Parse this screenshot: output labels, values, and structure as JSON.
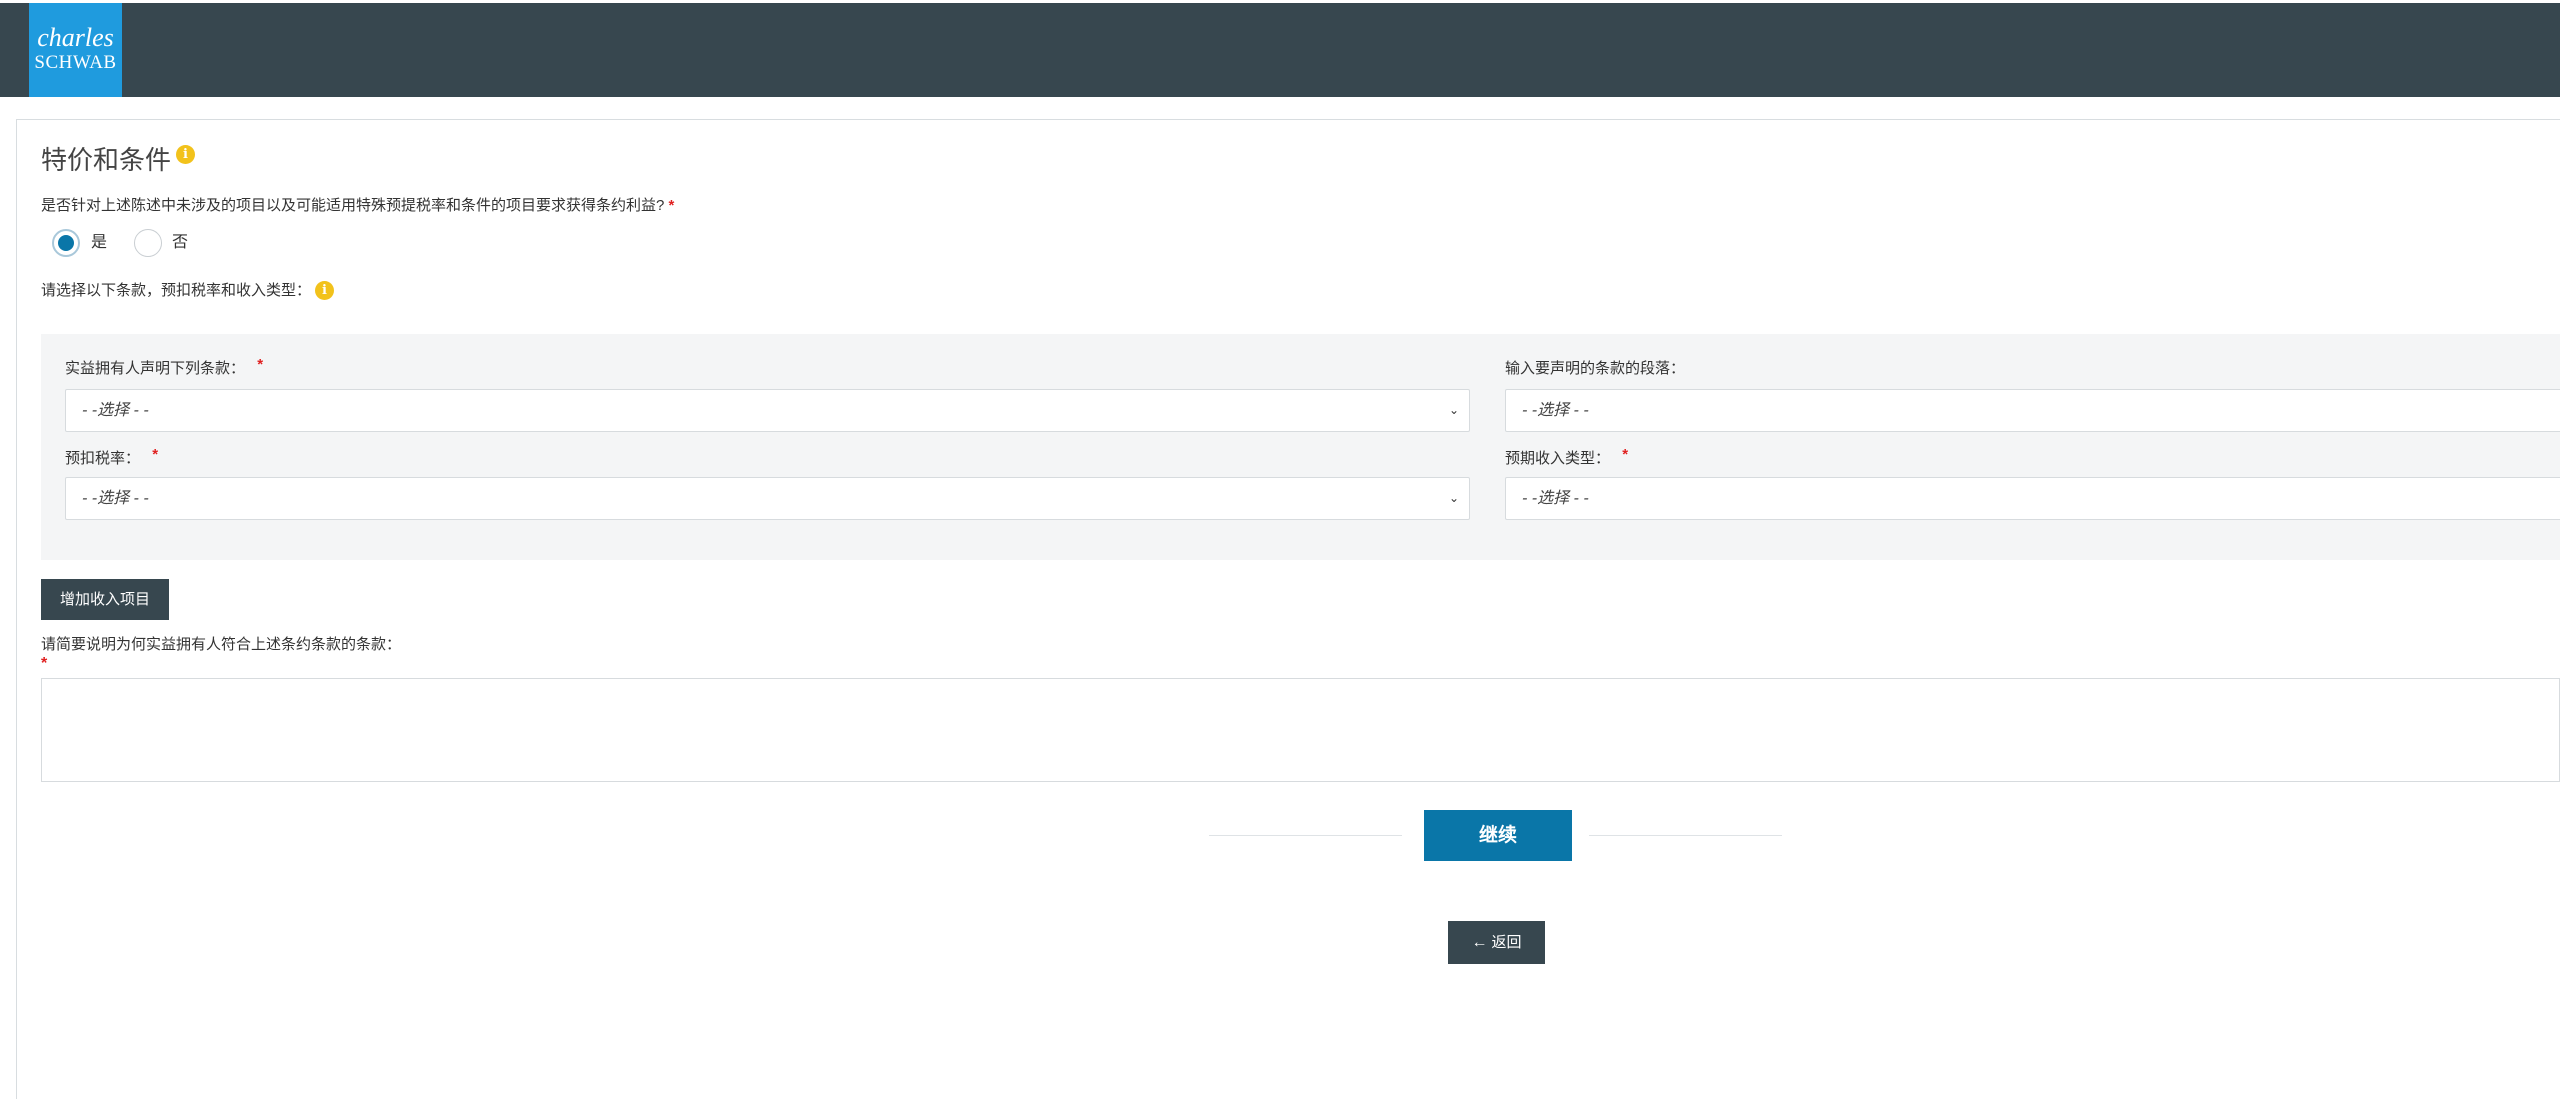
{
  "header": {
    "logo_line1": "charles",
    "logo_line2": "SCHWAB"
  },
  "section": {
    "title": "特价和条件",
    "question": "是否针对上述陈述中未涉及的项目以及可能适用特殊预提税率和条件的项目要求获得条约利益?",
    "required_mark": "*",
    "options": [
      {
        "label": "是",
        "selected": true
      },
      {
        "label": "否",
        "selected": false
      }
    ],
    "instructions": "请选择以下条款，预扣税率和收入类型："
  },
  "form": {
    "article_label": "实益拥有人声明下列条款：",
    "article_value": "- -选择 - -",
    "paragraph_label": "输入要声明的条款的段落：",
    "paragraph_value": "- -选择 - -",
    "rate_label": "预扣税率：",
    "rate_value": "- -选择 - -",
    "income_label": "预期收入类型：",
    "income_value": "- -选择 - -",
    "add_income_button": "增加收入项目",
    "explain_label": "请简要说明为何实益拥有人符合上述条约条款的条款：",
    "explain_value": ""
  },
  "actions": {
    "continue_label": "继续",
    "back_label": "返回"
  },
  "icons": {
    "info": "info-icon",
    "dropdown": "chevron-down-icon",
    "back": "arrow-left-icon"
  },
  "colors": {
    "header_bg": "#37474f",
    "logo_bg": "#1f9bde",
    "primary": "#0a76a8",
    "info_yellow": "#f2c21b",
    "required_red": "#e02020"
  }
}
